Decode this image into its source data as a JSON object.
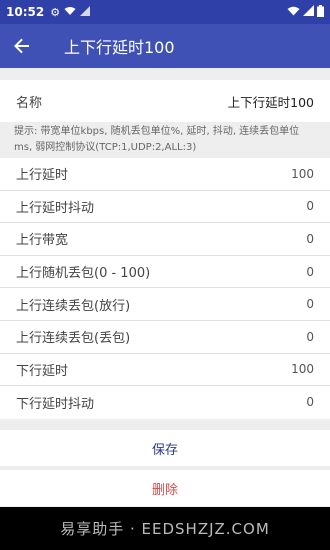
{
  "status_bar": {
    "time": "10:52",
    "icons": [
      "gear-icon",
      "wifi-icon",
      "signal-icon",
      "battery-icon"
    ]
  },
  "app_bar": {
    "title": "上下行延时100"
  },
  "name_row": {
    "label": "名称",
    "value": "上下行延时100"
  },
  "hint": {
    "text": "提示: 带宽单位kbps, 随机丢包单位%, 延时, 抖动, 连续丢包单位ms, 弱网控制协议(TCP:1,UDP:2,ALL:3)"
  },
  "rows": [
    {
      "label": "上行延时",
      "value": "100"
    },
    {
      "label": "上行延时抖动",
      "value": "0"
    },
    {
      "label": "上行带宽",
      "value": "0"
    },
    {
      "label": "上行随机丢包(0 - 100)",
      "value": "0"
    },
    {
      "label": "上行连续丢包(放行)",
      "value": "0"
    },
    {
      "label": "上行连续丢包(丢包)",
      "value": "0"
    },
    {
      "label": "下行延时",
      "value": "100"
    },
    {
      "label": "下行延时抖动",
      "value": "0"
    }
  ],
  "actions": {
    "save": "保存",
    "delete": "删除"
  },
  "watermark": "易享助手 · EEDSHZJZ.COM"
}
